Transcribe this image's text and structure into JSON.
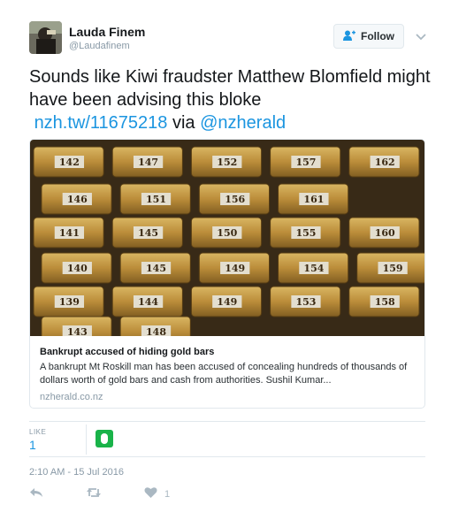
{
  "user": {
    "display_name": "Lauda Finem",
    "handle": "@Laudafinem",
    "avatar_icon": "avatar-photo"
  },
  "follow": {
    "label": "Follow",
    "icon": "add-user-icon",
    "accent": "#1b95e0"
  },
  "tweet": {
    "text": "Sounds like Kiwi fraudster Matthew Blomfield might have been advising this bloke",
    "link": "nzh.tw/11675218",
    "via": "via",
    "mention": "@nzherald"
  },
  "card": {
    "title": "Bankrupt accused of hiding gold bars",
    "description": "A bankrupt Mt Roskill man has been accused of concealing hundreds of thousands of dollars worth of gold bars and cash from authorities. Sushil Kumar...",
    "domain": "nzherald.co.nz",
    "bar_numbers": [
      "142",
      "147",
      "152",
      "157",
      "162",
      "146",
      "151",
      "156",
      "161",
      "141",
      "145",
      "150",
      "155",
      "160",
      "140",
      "145",
      "149",
      "154",
      "159",
      "139",
      "144",
      "149",
      "153",
      "158",
      "143",
      "148"
    ]
  },
  "stats": {
    "likes_label": "LIKE",
    "likes_count": "1"
  },
  "timestamp": "2:10 AM - 15 Jul 2016",
  "actions": {
    "like_count": "1"
  }
}
